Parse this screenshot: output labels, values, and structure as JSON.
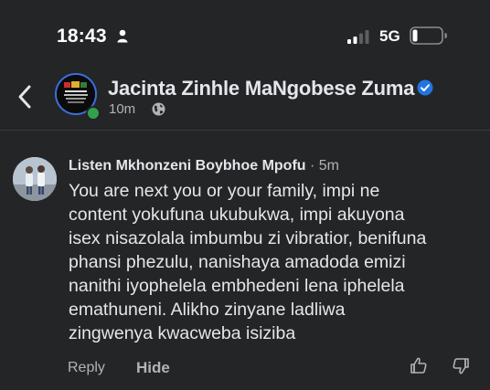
{
  "status_bar": {
    "time": "18:43",
    "network": "5G",
    "icons": [
      "person-icon",
      "signal-bars-icon",
      "battery-icon"
    ]
  },
  "header": {
    "back_icon": "chevron-left-icon",
    "page_name": "Jacinta Zinhle MaNgobese Zuma",
    "verified_icon": "verified-badge-icon",
    "post_time": "10m",
    "audience_icon": "globe-icon",
    "online_color": "#31a24c",
    "verified_color": "#2374e1"
  },
  "comment": {
    "author": "Listen Mkhonzeni Boybhoe Mpofu",
    "separator": "·",
    "time": "5m",
    "lines": [
      "You are next you or your family, impi ne",
      "content yokufuna ukubukwa, impi akuyona",
      "isex nisazolala imbumbu zi vibratior,  benifuna",
      "phansi phezulu,  nanishaya amadoda emizi",
      "nanithi iyophelela embhedeni lena iphelela",
      "emathuneni.   Alikho zinyane ladliwa",
      "zingwenya kwacweba isiziba"
    ],
    "actions": {
      "reply": "Reply",
      "hide": "Hide",
      "like_icon": "thumbs-up-icon",
      "dislike_icon": "thumbs-down-icon"
    }
  },
  "colors": {
    "background": "#242526",
    "text_primary": "#e4e6eb",
    "text_secondary": "#b0b3b8"
  }
}
